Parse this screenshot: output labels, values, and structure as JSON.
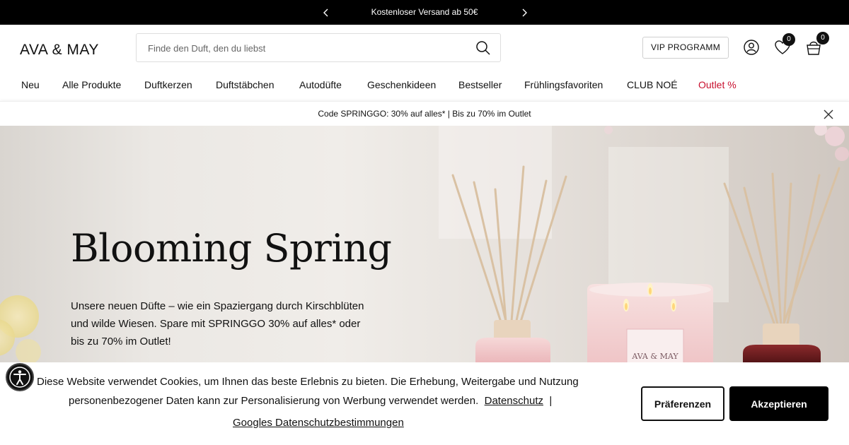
{
  "announcement": {
    "message": "Kostenloser Versand ab 50€",
    "prev_icon": "chevron-left-icon",
    "next_icon": "chevron-right-icon"
  },
  "header": {
    "logo": "AVA & MAY",
    "search": {
      "placeholder": "Finde den Duft, den du liebst",
      "value": "",
      "icon": "search-icon"
    },
    "vip_label": "VIP PROGRAMM",
    "account_icon": "user-icon",
    "wishlist": {
      "icon": "heart-icon",
      "count": "0"
    },
    "cart": {
      "icon": "shopping-bag-icon",
      "count": "0"
    }
  },
  "nav": {
    "items": [
      {
        "label": "Neu"
      },
      {
        "label": "Alle Produkte"
      },
      {
        "label": "Duftkerzen"
      },
      {
        "label": "Duftstäbchen"
      },
      {
        "label": "Autodüfte"
      },
      {
        "label": "Geschenkideen"
      },
      {
        "label": "Bestseller"
      },
      {
        "label": "Frühlingsfavoriten"
      },
      {
        "label": "CLUB NOÉ"
      },
      {
        "label": "Outlet %"
      }
    ],
    "outlet_color": "#c8102e"
  },
  "promo": {
    "text": "Code SPRINGGO: 30% auf alles* | Bis zu 70% im Outlet",
    "close_icon": "close-icon"
  },
  "hero": {
    "title": "Blooming Spring",
    "body": "Unsere neuen Düfte – wie ein Spaziergang durch Kirschblüten und wilde Wiesen. Spare mit SPRINGGO 30% auf alles* oder bis zu 70% im Outlet!",
    "jar_label": "AVA & MAY"
  },
  "cookie": {
    "text_line1": "Diese Website verwendet Cookies, um Ihnen das beste Erlebnis zu bieten. Die Erhebung, Weitergabe und Nutzung",
    "text_line2": "personenbezogener Daten kann zur Personalisierung von Werbung verwendet werden.",
    "privacy_link": "Datenschutz",
    "separator": "|",
    "google_link": "Googles Datenschutzbestimmungen",
    "preferences_label": "Präferenzen",
    "accept_label": "Akzeptieren",
    "accessibility_icon": "accessibility-icon"
  }
}
